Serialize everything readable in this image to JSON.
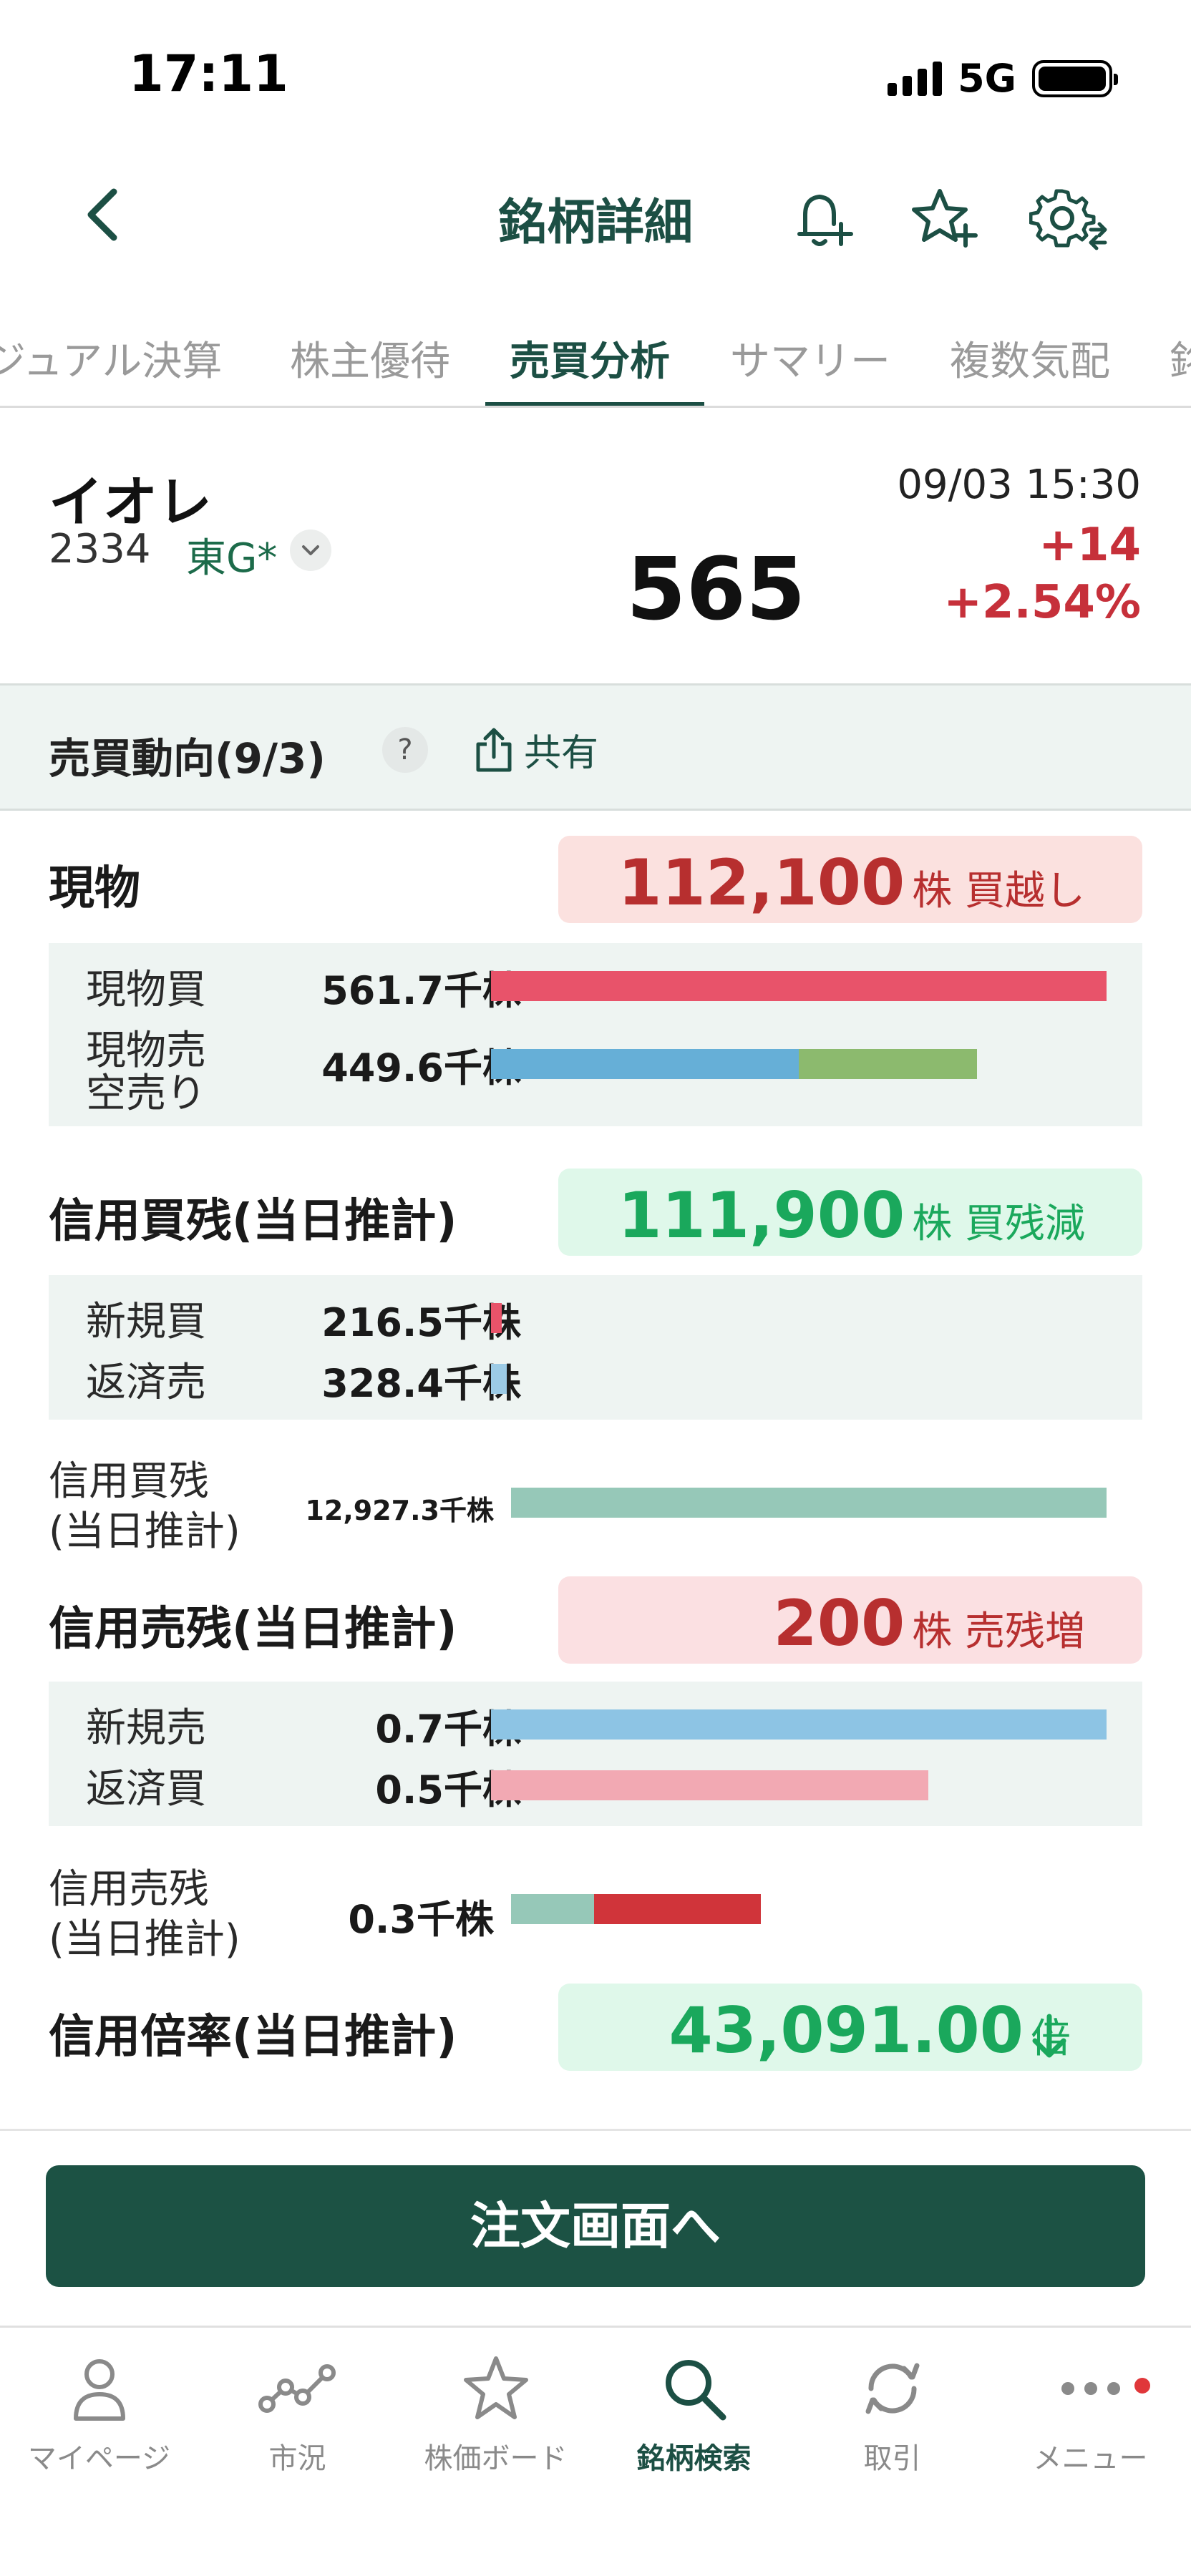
{
  "status": {
    "time": "17:11",
    "network": "5G"
  },
  "header": {
    "title": "銘柄詳細"
  },
  "tabs": [
    {
      "label": "ジュアル決算"
    },
    {
      "label": "株主優待"
    },
    {
      "label": "売買分析"
    },
    {
      "label": "サマリー"
    },
    {
      "label": "複数気配"
    },
    {
      "label": "銘"
    }
  ],
  "stock": {
    "name": "イオレ",
    "code": "2334",
    "market": "東G*",
    "price": "565",
    "datetime": "09/03 15:30",
    "change": "+14",
    "change_pct": "+2.54%"
  },
  "section": {
    "title": "売買動向(9/3)",
    "help": "?",
    "share_label": "共有"
  },
  "genbutsu": {
    "title": "現物",
    "badge_value": "112,100",
    "badge_unit": "株 買越し",
    "buy_label": "現物買",
    "buy_value": "561.7千株",
    "sell_label_1": "現物売",
    "sell_label_2": "空売り",
    "sell_value": "449.6千株",
    "buy_ratio": 1.0,
    "sell_ratio": 0.5,
    "short_ratio": 0.29
  },
  "margin_buy": {
    "title": "信用買残(当日推計)",
    "badge_value": "111,900",
    "badge_unit": "株 買残減",
    "new_label": "新規買",
    "new_value": "216.5千株",
    "repay_label": "返済売",
    "repay_value": "328.4千株",
    "balance_label_1": "信用買残",
    "balance_label_2": "(当日推計)",
    "balance_value": "12,927.3千株",
    "new_ratio": 0.017,
    "repay_ratio": 0.025,
    "balance_ratio": 1.0
  },
  "margin_sell": {
    "title": "信用売残(当日推計)",
    "badge_value": "200",
    "badge_unit": "株 売残増",
    "new_label": "新規売",
    "new_value": "0.7千株",
    "repay_label": "返済買",
    "repay_value": "0.5千株",
    "balance_label_1": "信用売残",
    "balance_label_2": "(当日推計)",
    "balance_value": "0.3千株",
    "new_ratio": 1.0,
    "repay_ratio": 0.71,
    "balance_prev_ratio": 0.14,
    "balance_inc_ratio": 0.28
  },
  "ratio": {
    "title": "信用倍率(当日推計)",
    "badge_value": "43,091.00",
    "badge_unit": "倍"
  },
  "action": {
    "order_label": "注文画面へ"
  },
  "bottom_nav": [
    {
      "label": "マイページ"
    },
    {
      "label": "市況"
    },
    {
      "label": "株価ボード"
    },
    {
      "label": "銘柄検索"
    },
    {
      "label": "取引"
    },
    {
      "label": "メニュー"
    }
  ],
  "colors": {
    "accent": "#1c4f44",
    "up": "#c6303a",
    "buy_bar": "#e8536a",
    "sell_bar": "#66afd7",
    "short_bar": "#8cba6e",
    "margin_balance": "#96c8b8",
    "sell_repay_bar": "#f2a9b3",
    "sell_balance_inc": "#d0343a"
  }
}
